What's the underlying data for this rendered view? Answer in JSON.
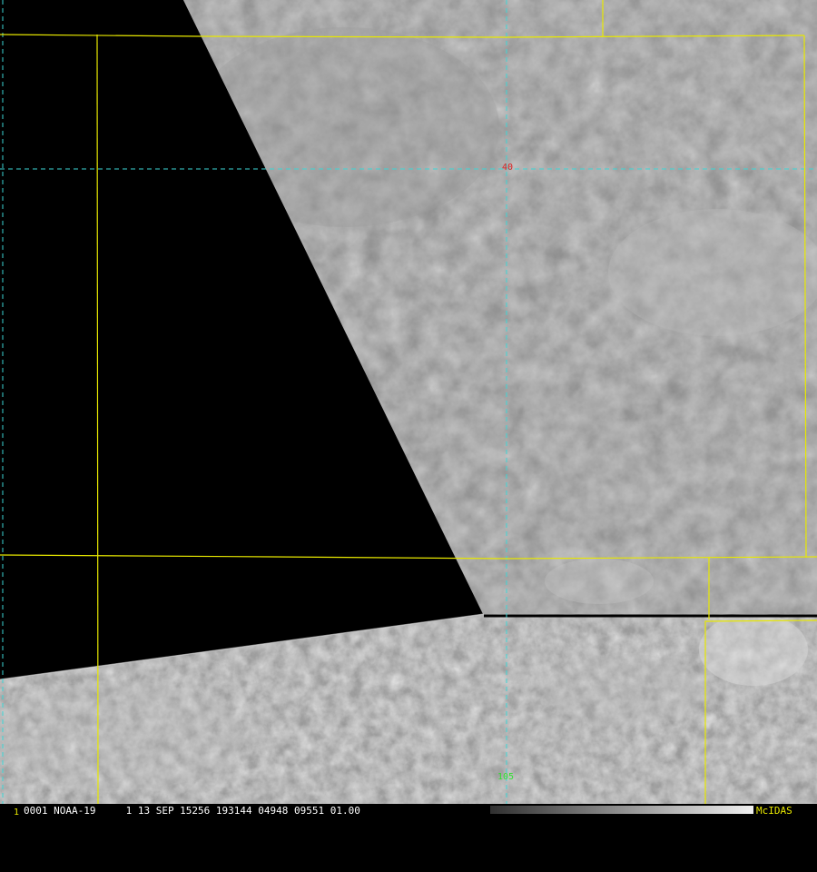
{
  "overlay": {
    "latitude_label": "40",
    "longitude_label": "105"
  },
  "status_bar": {
    "frame_number": "1",
    "text": "0001 NOAA-19     1 13 SEP 15256 193144 04948 09551 01.00",
    "brand": "McIDAS"
  },
  "colors": {
    "political_boundary": "#e8e800",
    "lat_lon_grid": "#3cd6d6",
    "latitude_label": "#e02020",
    "longitude_label": "#30e030",
    "status_text": "#ffffff",
    "brand_text": "#e8e800",
    "no_data": "#000000"
  }
}
